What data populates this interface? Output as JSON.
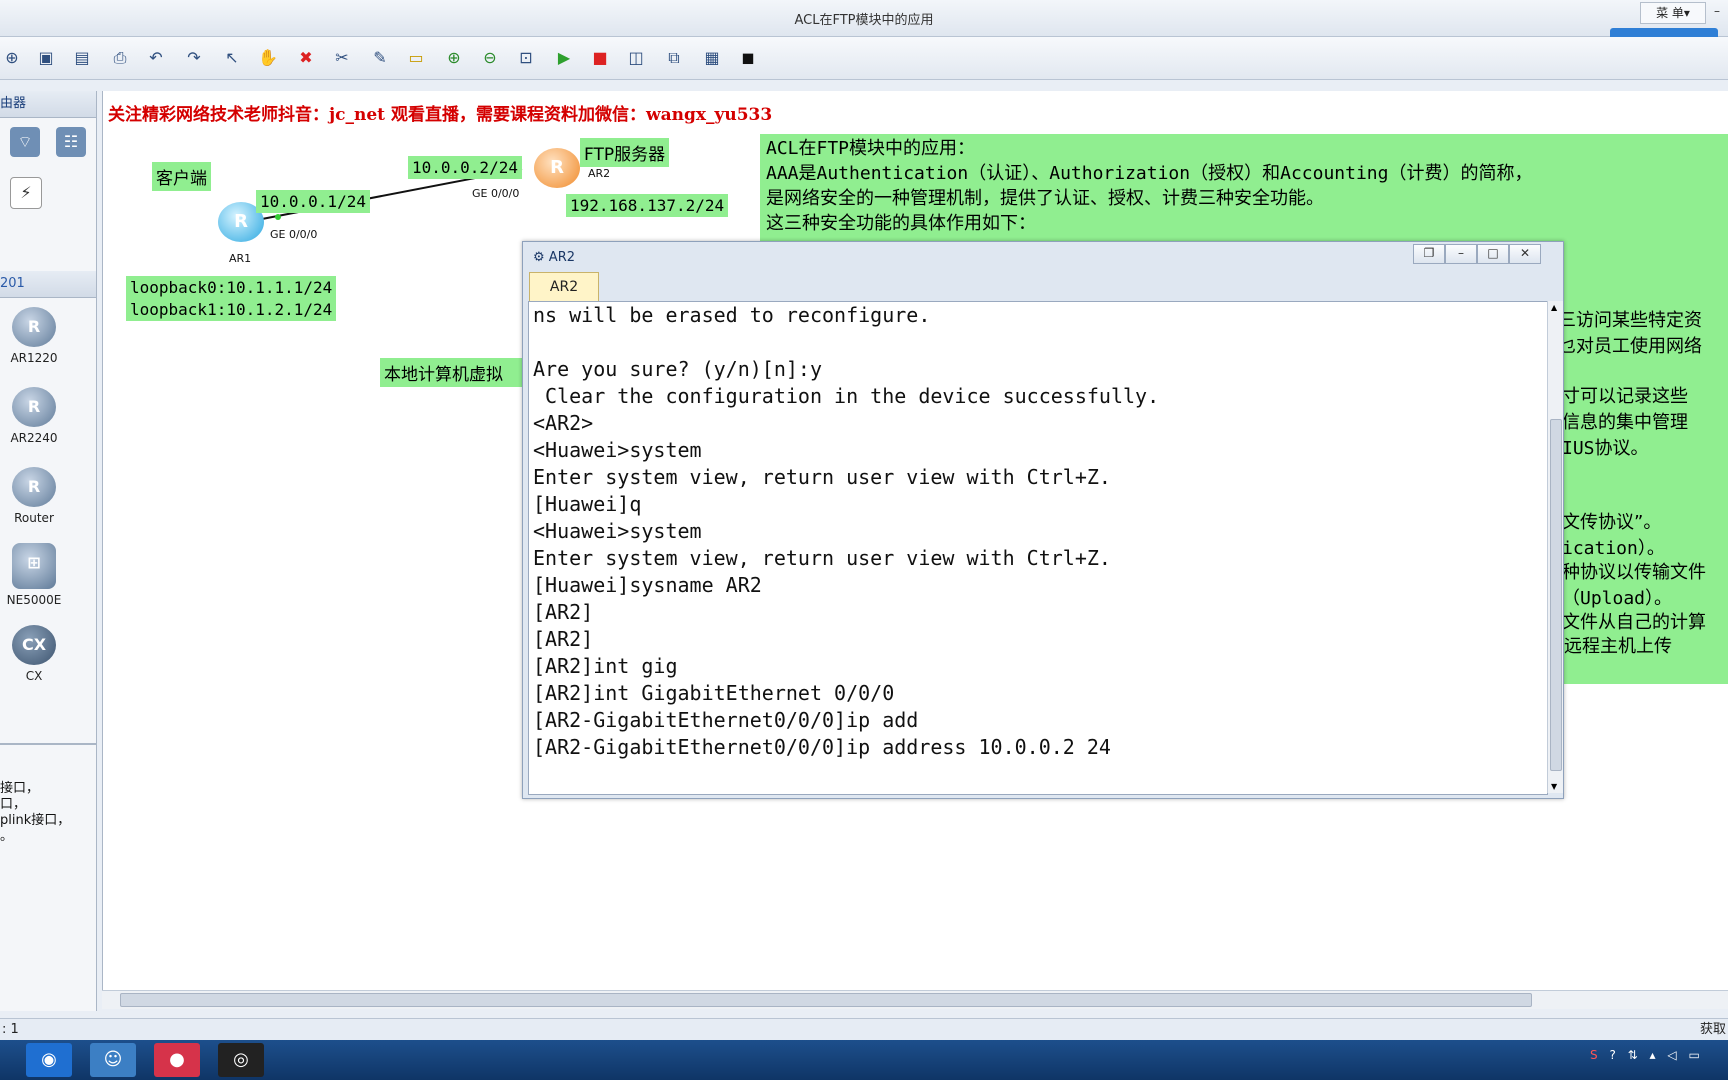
{
  "window": {
    "title": "ACL在FTP模块中的应用",
    "menu_label": "菜 单▾",
    "minimize_label": "–"
  },
  "left_panel": {
    "header_top": "由器",
    "header_mid": "201",
    "devices": [
      {
        "label": "AR1220"
      },
      {
        "label": "AR2240"
      },
      {
        "label": "Router"
      },
      {
        "label": "NE5000E"
      },
      {
        "label": "CX"
      }
    ],
    "description_lines": [
      "接口，",
      "口，",
      "plink接口，",
      "。"
    ]
  },
  "canvas": {
    "header_banner": "关注精彩网络技术老师抖音：jc_net 观看直播，需要课程资料加微信：wangx_yu533",
    "client_label": "客户端",
    "server_label": "FTP服务器",
    "ar1_ip": "10.0.0.1/24",
    "ar2_ip": "10.0.0.2/24",
    "ar1_name": "AR1",
    "ar2_name": "AR2",
    "ar1_port": "GE 0/0/0",
    "ar2_port": "GE 0/0/0",
    "server_ip": "192.168.137.2/24",
    "loopback0": "loopback0:10.1.1.1/24",
    "loopback1": "loopback1:10.1.2.1/24",
    "local_vm_label": "本地计算机虚拟"
  },
  "info_panel": {
    "lines": [
      "ACL在FTP模块中的应用：",
      "   AAA是Authentication（认证）、Authorization（授权）和Accounting（计费）的简称，",
      "是网络安全的一种管理机制，提供了认证、授权、计费三种安全功能。",
      "这三种安全功能的具体作用如下："
    ],
    "right_fragments": [
      "三访问某些特定资",
      "乜对员工使用网络",
      "寸可以记录这些",
      "信息的集中管理",
      "IUS协议。",
      "文传协议”。",
      "ication）。",
      "种协议以传输文件",
      "（Upload）。",
      "文件从自己的计算",
      "远程主机上传"
    ]
  },
  "console": {
    "title": "AR2",
    "tab_label": "AR2",
    "lines": [
      "ns will be erased to reconfigure.",
      "",
      "Are you sure? (y/n)[n]:y",
      " Clear the configuration in the device successfully.",
      "<AR2>",
      "<Huawei>system",
      "Enter system view, return user view with Ctrl+Z.",
      "[Huawei]q",
      "<Huawei>system",
      "Enter system view, return user view with Ctrl+Z.",
      "[Huawei]sysname AR2",
      "[AR2]",
      "[AR2]",
      "[AR2]int gig",
      "[AR2]int GigabitEthernet 0/0/0",
      "[AR2-GigabitEthernet0/0/0]ip add",
      "[AR2-GigabitEthernet0/0/0]ip address 10.0.0.2 24"
    ]
  },
  "status_bar": {
    "left": ": 1",
    "right": "获取"
  }
}
